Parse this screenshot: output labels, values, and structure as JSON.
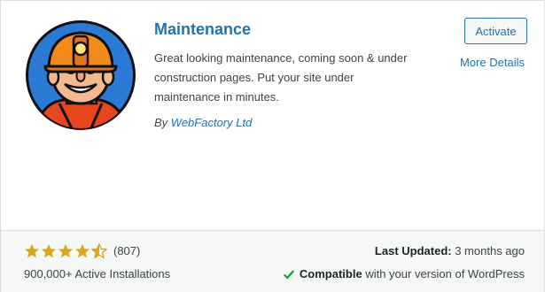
{
  "plugin": {
    "name": "Maintenance",
    "description": "Great looking maintenance, coming soon & under construction pages. Put your site under maintenance in minutes.",
    "author_prefix": "By",
    "author": "WebFactory Ltd",
    "icon": "miner-mascot-icon"
  },
  "actions": {
    "activate_label": "Activate",
    "more_details_label": "More Details"
  },
  "footer": {
    "rating": {
      "stars": 4.5,
      "max": 5,
      "count_label": "(807)"
    },
    "installs": "900,000+ Active Installations",
    "last_updated_label": "Last Updated:",
    "last_updated_value": "3 months ago",
    "compat_strong": "Compatible",
    "compat_rest": "with your version of WordPress"
  },
  "colors": {
    "link": "#2271b1",
    "star": "#dba617",
    "check": "#00a32a",
    "footer_bg": "#f6f7f7"
  }
}
